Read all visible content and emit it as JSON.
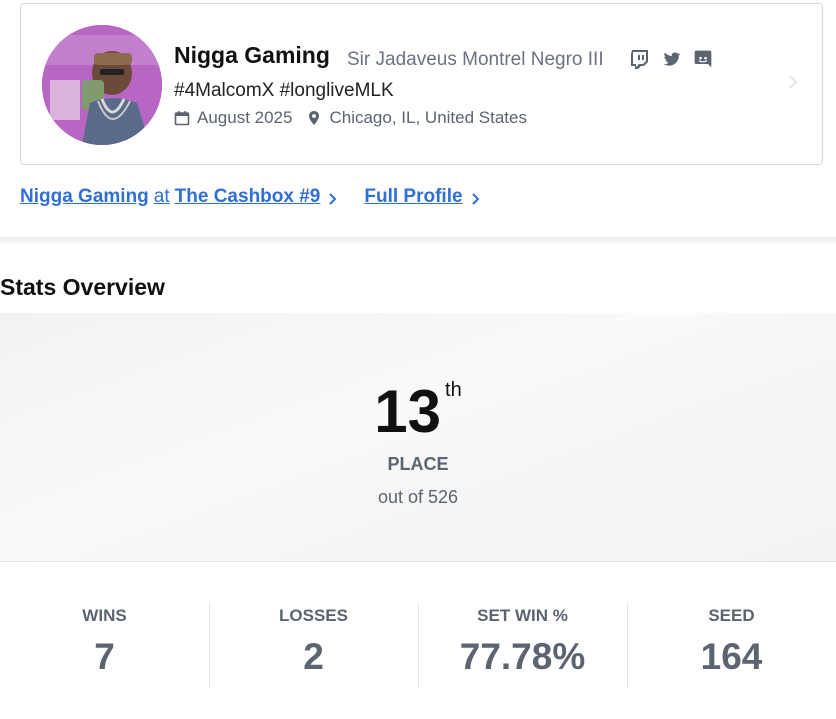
{
  "profile": {
    "name": "Nigga Gaming",
    "real_name": "Sir Jadaveus Montrel Negro III",
    "tagline": "#4MalcomX #longliveMLK",
    "joined": "August 2025",
    "location": "Chicago, IL, United States",
    "socials": [
      "twitch-icon",
      "twitter-icon",
      "discord-icon"
    ]
  },
  "links": {
    "player": "Nigga Gaming",
    "at": "at",
    "tournament": "The Cashbox #9",
    "full_profile": "Full Profile"
  },
  "stats_overview": {
    "title": "Stats Overview",
    "rank": "13",
    "rank_suffix": "th",
    "place_label": "PLACE",
    "out_of": "out of 526"
  },
  "stats": [
    {
      "label": "WINS",
      "value": "7"
    },
    {
      "label": "LOSSES",
      "value": "2"
    },
    {
      "label": "SET WIN %",
      "value": "77.78%"
    },
    {
      "label": "SEED",
      "value": "164"
    }
  ],
  "colors": {
    "link": "#2f6fd6",
    "muted": "#5b6470",
    "avatar_bg": "#b25bc0"
  }
}
